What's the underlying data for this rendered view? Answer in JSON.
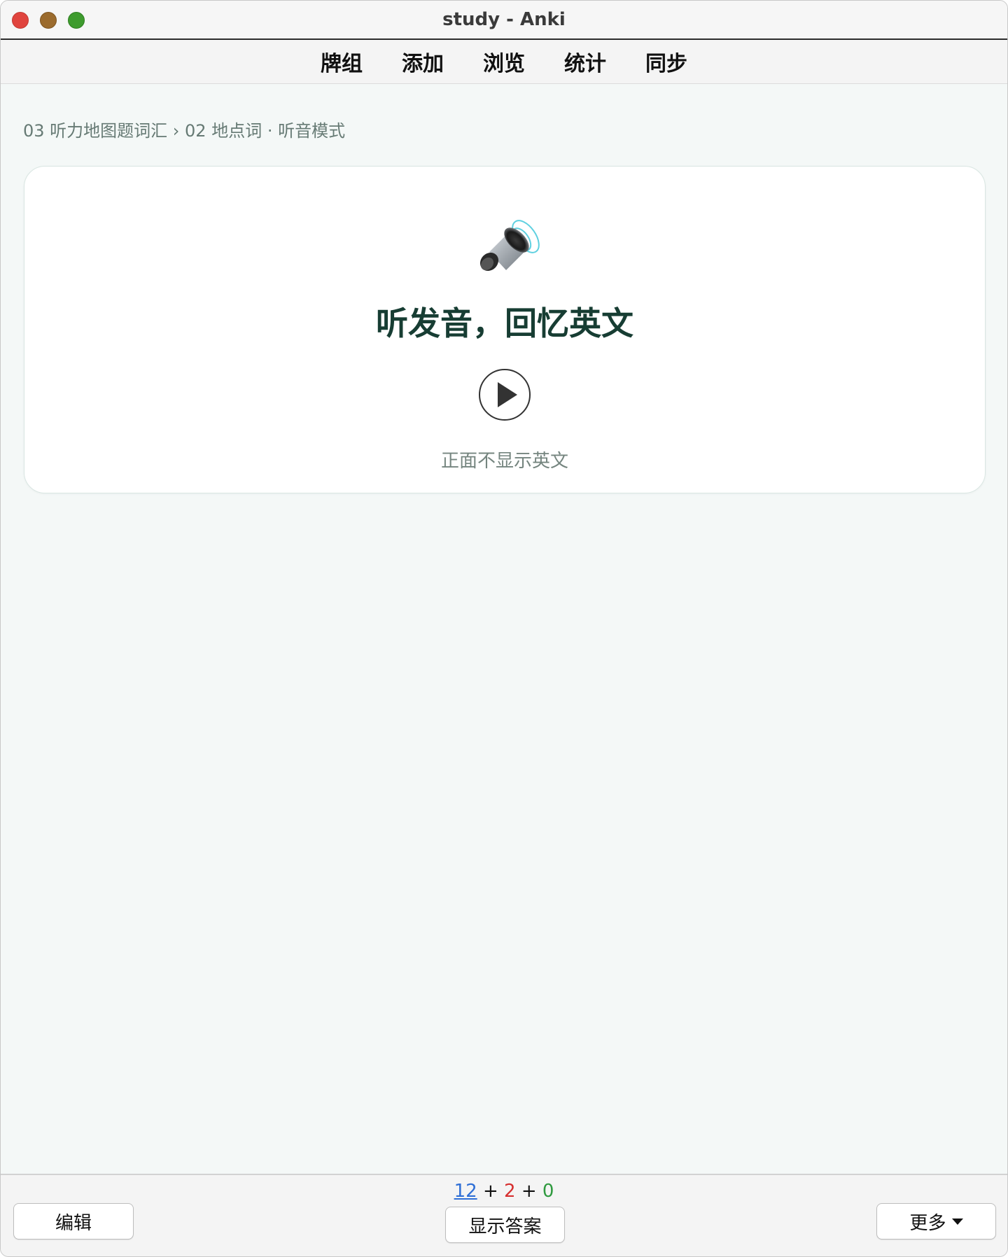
{
  "window": {
    "title": "study - Anki"
  },
  "toolbar": {
    "tabs": [
      {
        "label": "牌组"
      },
      {
        "label": "添加"
      },
      {
        "label": "浏览"
      },
      {
        "label": "统计"
      },
      {
        "label": "同步"
      }
    ]
  },
  "breadcrumb": {
    "text": "03 听力地图题词汇 › 02 地点词 · 听音模式"
  },
  "card": {
    "icon": "speaker-icon",
    "heading": "听发音，回忆英文",
    "play_icon": "play-icon",
    "hint": "正面不显示英文"
  },
  "bottom": {
    "edit_label": "编辑",
    "show_answer_label": "显示答案",
    "more_label": "更多",
    "counts": {
      "new": "12",
      "plus1": "+",
      "learn": "2",
      "plus2": "+",
      "review": "0"
    }
  },
  "colors": {
    "accent_new": "#2f6fd6",
    "accent_learn": "#d62f2f",
    "accent_review": "#2f9a3f",
    "heading": "#173d33",
    "background": "#f4f8f7"
  }
}
